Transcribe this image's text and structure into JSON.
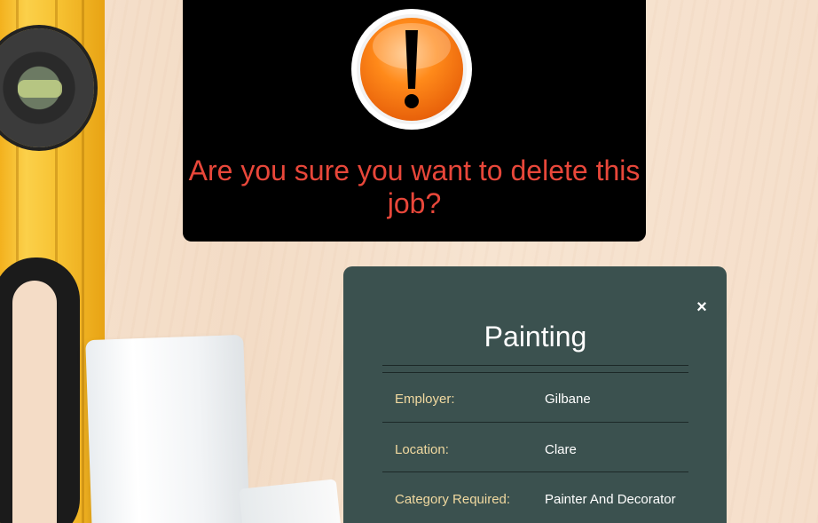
{
  "alert": {
    "icon": "warning-exclamation-icon",
    "message": "Are you sure you want to delete this job?",
    "message_color": "#e8473a"
  },
  "job": {
    "close_label": "×",
    "title": "Painting",
    "details": [
      {
        "label": "Employer:",
        "value": "Gilbane"
      },
      {
        "label": "Location:",
        "value": "Clare"
      },
      {
        "label": "Category Required:",
        "value": "Painter And Decorator"
      }
    ]
  },
  "colors": {
    "card_background": "#3b514f",
    "label_color": "#f1d9a0",
    "alert_background": "#000000"
  }
}
